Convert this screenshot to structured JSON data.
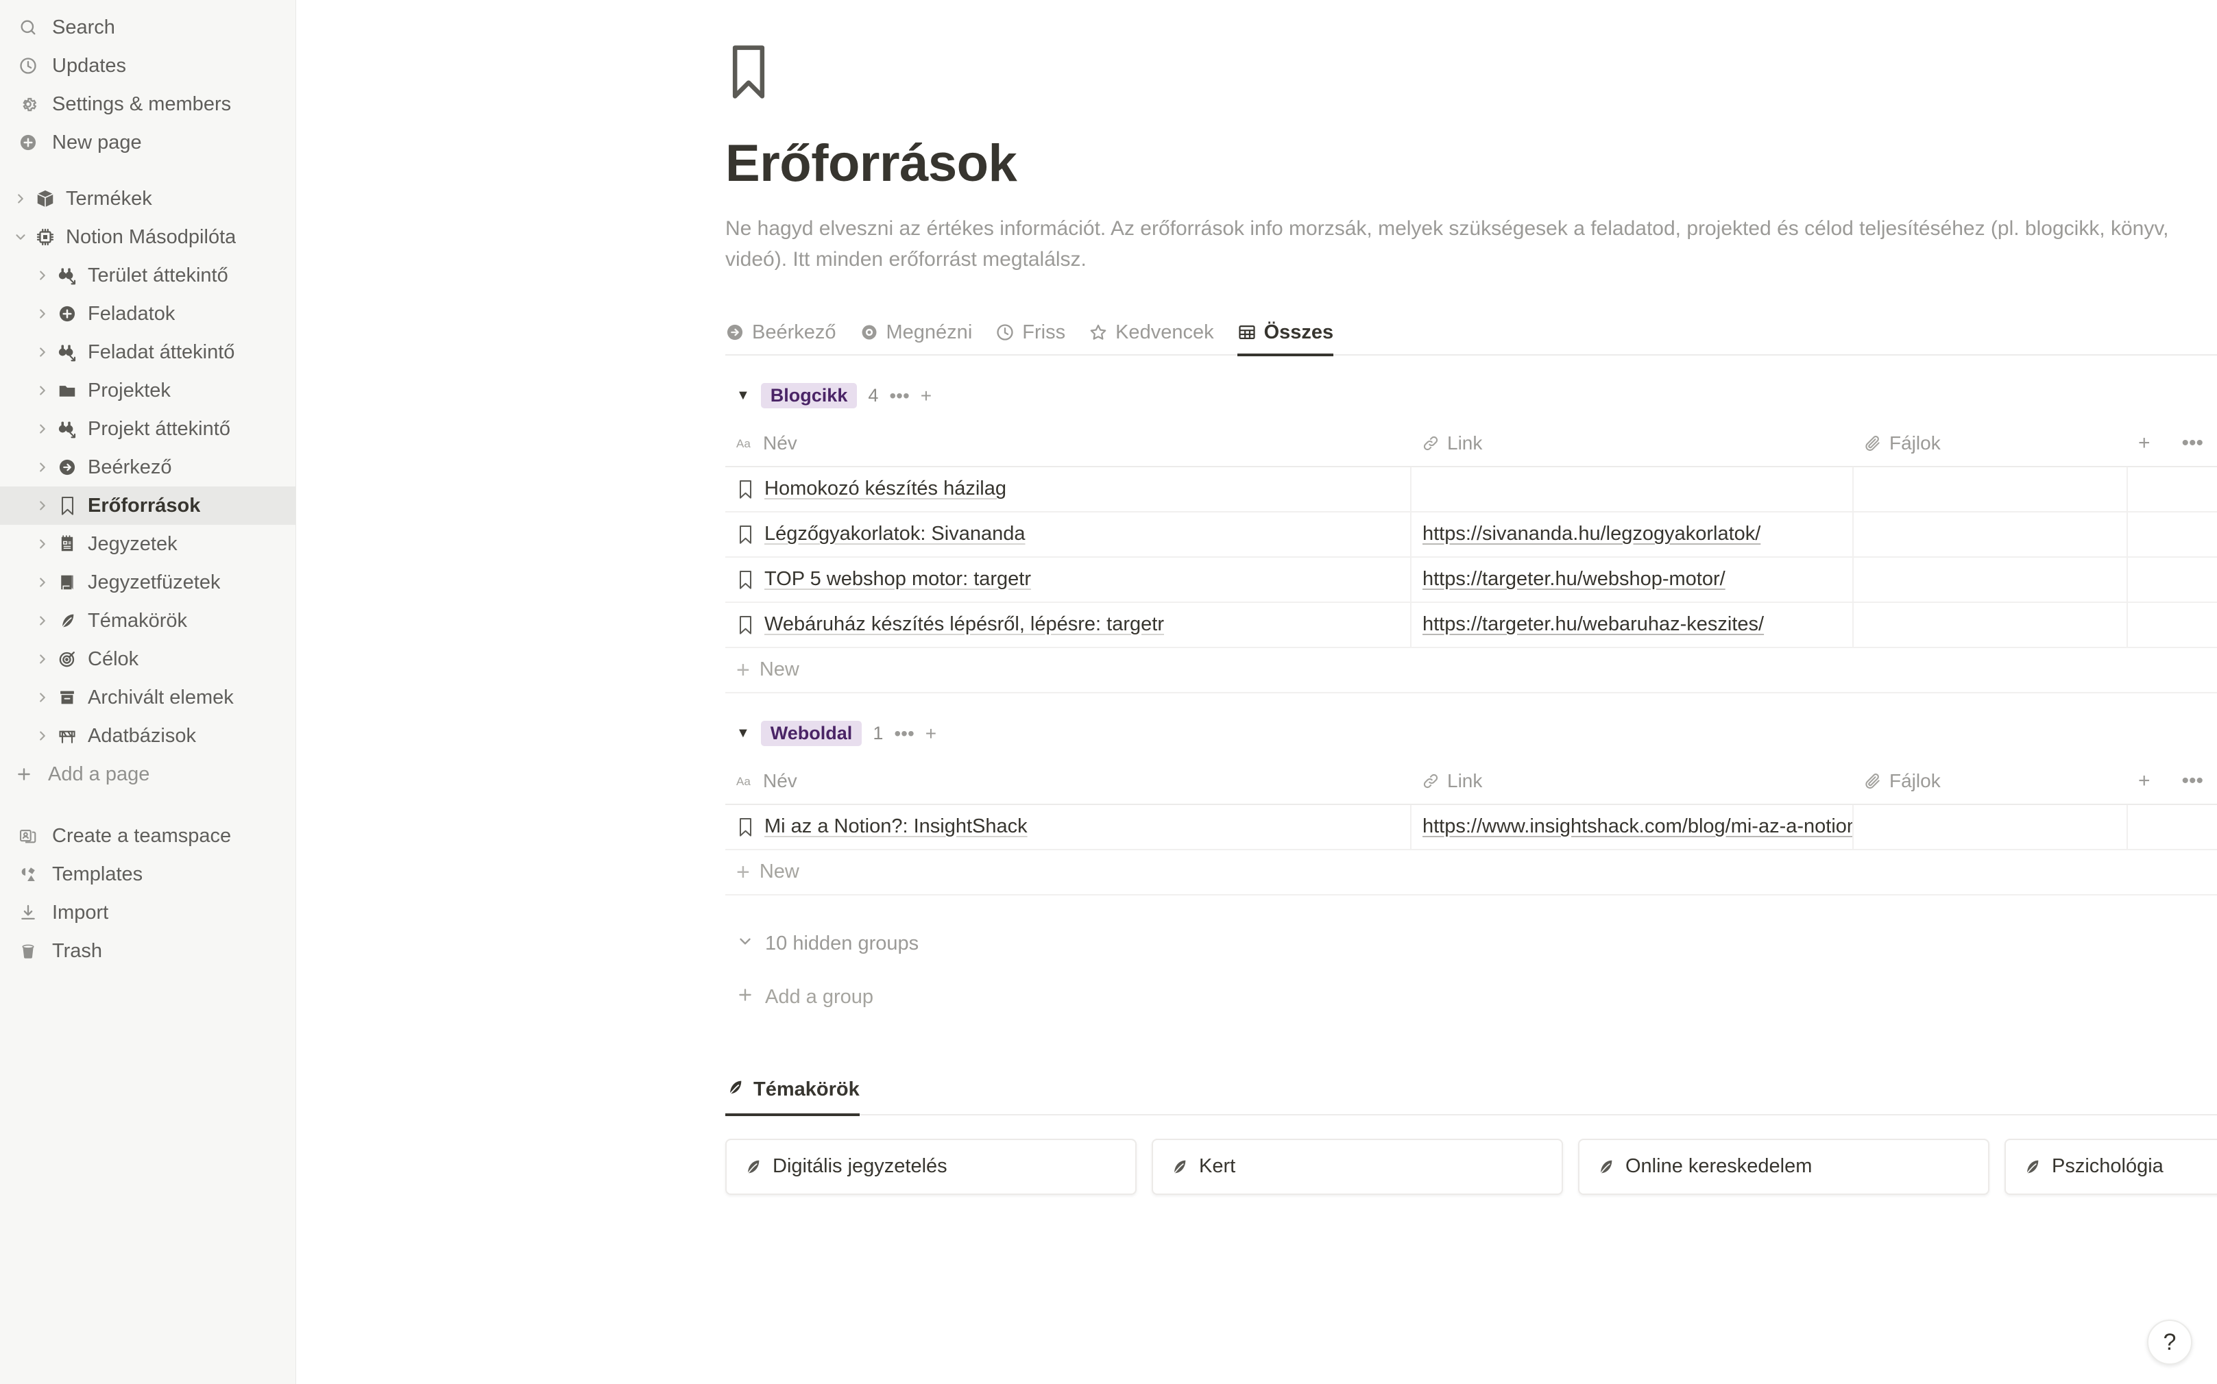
{
  "sidebar": {
    "top_items": [
      {
        "label": "Search",
        "icon": "search-icon"
      },
      {
        "label": "Updates",
        "icon": "clock-icon"
      },
      {
        "label": "Settings & members",
        "icon": "gear-icon"
      },
      {
        "label": "New page",
        "icon": "plus-circle-icon"
      }
    ],
    "tree": [
      {
        "label": "Termékek",
        "icon": "package-icon",
        "depth": 0,
        "expanded": false,
        "selected": false
      },
      {
        "label": "Notion Másodpilóta",
        "icon": "chip-icon",
        "depth": 0,
        "expanded": true,
        "selected": false
      },
      {
        "label": "Terület áttekintő",
        "icon": "binoculars-icon",
        "depth": 1,
        "expanded": false,
        "selected": false
      },
      {
        "label": "Feladatok",
        "icon": "plus-circle-icon",
        "depth": 1,
        "expanded": false,
        "selected": false
      },
      {
        "label": "Feladat áttekintő",
        "icon": "binoculars-icon",
        "depth": 1,
        "expanded": false,
        "selected": false
      },
      {
        "label": "Projektek",
        "icon": "folder-icon",
        "depth": 1,
        "expanded": false,
        "selected": false
      },
      {
        "label": "Projekt áttekintő",
        "icon": "binoculars-icon",
        "depth": 1,
        "expanded": false,
        "selected": false
      },
      {
        "label": "Beérkező",
        "icon": "arrow-circle-icon",
        "depth": 1,
        "expanded": false,
        "selected": false
      },
      {
        "label": "Erőforrások",
        "icon": "bookmark-icon",
        "depth": 1,
        "expanded": false,
        "selected": true
      },
      {
        "label": "Jegyzetek",
        "icon": "notepad-icon",
        "depth": 1,
        "expanded": false,
        "selected": false
      },
      {
        "label": "Jegyzetfüzetek",
        "icon": "book-icon",
        "depth": 1,
        "expanded": false,
        "selected": false
      },
      {
        "label": "Témakörök",
        "icon": "leaf-icon",
        "depth": 1,
        "expanded": false,
        "selected": false
      },
      {
        "label": "Célok",
        "icon": "target-icon",
        "depth": 1,
        "expanded": false,
        "selected": false
      },
      {
        "label": "Archivált elemek",
        "icon": "archive-icon",
        "depth": 1,
        "expanded": false,
        "selected": false
      },
      {
        "label": "Adatbázisok",
        "icon": "barrier-icon",
        "depth": 1,
        "expanded": false,
        "selected": false
      }
    ],
    "add_page_label": "Add a page",
    "bottom_items": [
      {
        "label": "Create a teamspace",
        "icon": "teamspace-icon"
      },
      {
        "label": "Templates",
        "icon": "templates-icon"
      },
      {
        "label": "Import",
        "icon": "import-icon"
      },
      {
        "label": "Trash",
        "icon": "trash-icon"
      }
    ]
  },
  "page": {
    "icon": "bookmark-icon",
    "title": "Erőforrások",
    "description": "Ne hagyd elveszni az értékes információt. Az erőforrások info morzsák, melyek szükségesek a feladatod, projekted és célod teljesítéséhez (pl. blogcikk, könyv, videó). Itt minden erőforrást megtalálsz."
  },
  "views": [
    {
      "label": "Beérkező",
      "icon": "arrow-circle-icon",
      "active": false
    },
    {
      "label": "Megnézni",
      "icon": "eye-icon",
      "active": false
    },
    {
      "label": "Friss",
      "icon": "clock-icon",
      "active": false
    },
    {
      "label": "Kedvencek",
      "icon": "star-icon",
      "active": false
    },
    {
      "label": "Összes",
      "icon": "table-icon",
      "active": true
    }
  ],
  "table": {
    "columns": [
      {
        "label": "Név",
        "icon": "text-type-icon"
      },
      {
        "label": "Link",
        "icon": "link-icon"
      },
      {
        "label": "Fájlok",
        "icon": "paperclip-icon"
      }
    ],
    "header_add_label": "+",
    "header_more_label": "•••",
    "new_row_label": "New"
  },
  "groups": [
    {
      "name": "Blogcikk",
      "count": "4",
      "more_label": "•••",
      "add_label": "+",
      "rows": [
        {
          "name": "Homokozó készítés házilag",
          "link": "",
          "files": ""
        },
        {
          "name": "Légzőgyakorlatok: Sivananda",
          "link": "https://sivananda.hu/legzogyakorlatok/",
          "files": ""
        },
        {
          "name": "TOP 5 webshop motor: targetr",
          "link": "https://targeter.hu/webshop-motor/",
          "files": ""
        },
        {
          "name": "Webáruház készítés lépésről, lépésre: targetr",
          "link": "https://targeter.hu/webaruhaz-keszites/",
          "files": ""
        }
      ]
    },
    {
      "name": "Weboldal",
      "count": "1",
      "more_label": "•••",
      "add_label": "+",
      "rows": [
        {
          "name": "Mi az a Notion?: InsightShack",
          "link": "https://www.insightshack.com/blog/mi-az-a-notion",
          "files": ""
        }
      ]
    }
  ],
  "hidden_groups_label": "10 hidden groups",
  "add_group_label": "Add a group",
  "sub_database": {
    "tab_label": "Témakörök",
    "cards": [
      {
        "label": "Digitális jegyzetelés"
      },
      {
        "label": "Kert"
      },
      {
        "label": "Online kereskedelem"
      },
      {
        "label": "Pszichológia"
      }
    ]
  },
  "help_button_label": "?",
  "colors": {
    "sidebar_bg": "#f7f7f5",
    "text_primary": "#37352f",
    "text_muted": "#9b9a97",
    "tag_bg": "#e8deee",
    "tag_text": "#4a2466"
  }
}
